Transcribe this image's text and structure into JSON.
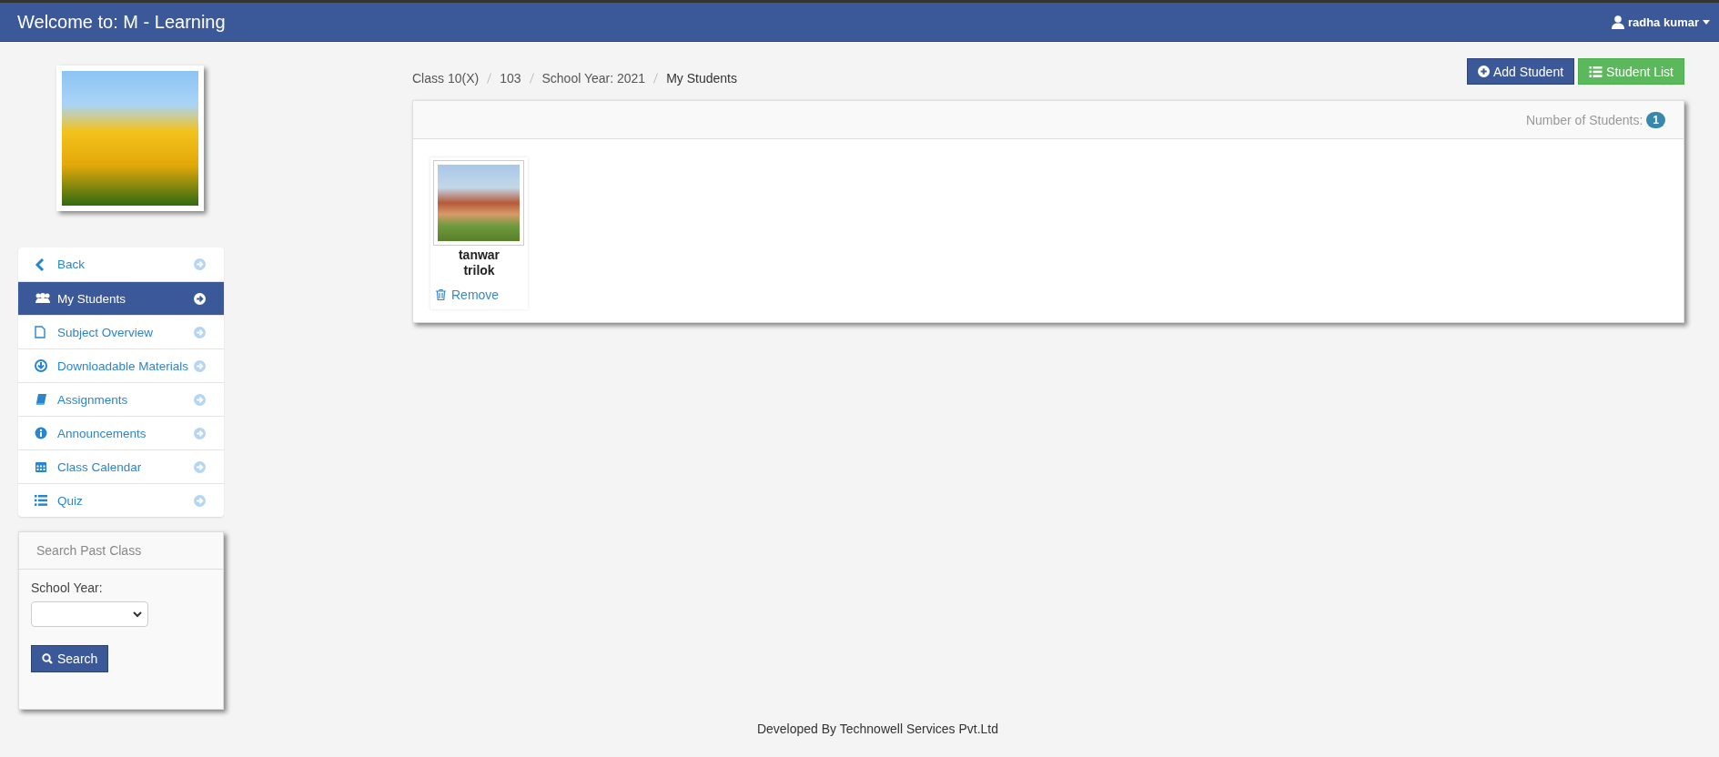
{
  "header": {
    "title": "Welcome to: M - Learning",
    "user": "radha kumar"
  },
  "sidebar": {
    "items": [
      {
        "label": "Back",
        "selected": false
      },
      {
        "label": "My Students",
        "selected": true
      },
      {
        "label": "Subject Overview",
        "selected": false
      },
      {
        "label": "Downloadable Materials",
        "selected": false
      },
      {
        "label": "Assignments",
        "selected": false
      },
      {
        "label": "Announcements",
        "selected": false
      },
      {
        "label": "Class Calendar",
        "selected": false
      },
      {
        "label": "Quiz",
        "selected": false
      }
    ]
  },
  "search_panel": {
    "title": "Search Past Class",
    "field_label": "School Year:",
    "button": "Search"
  },
  "breadcrumb": [
    "Class 10(X)",
    "103",
    "School Year: 2021",
    "My Students"
  ],
  "buttons": [
    {
      "label": "Add Student",
      "kind": "add"
    },
    {
      "label": "Student List",
      "kind": "list"
    }
  ],
  "students_panel": {
    "count_label": "Number of Students:",
    "count": "1",
    "students": [
      {
        "first": "tanwar",
        "last": "trilok",
        "action": "Remove"
      }
    ]
  },
  "footer": "Developed By Technowell Services Pvt.Ltd"
}
